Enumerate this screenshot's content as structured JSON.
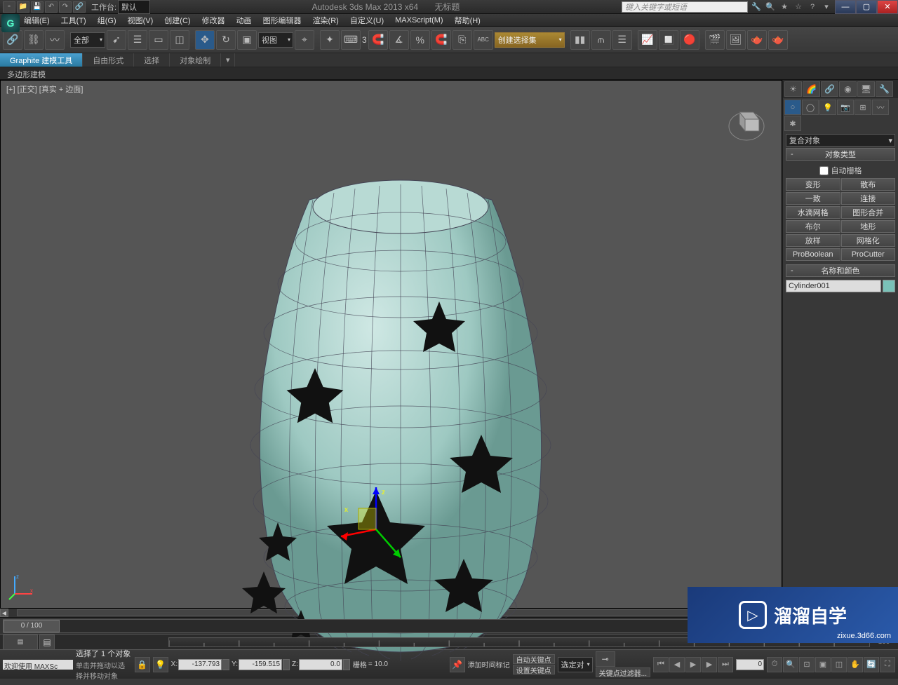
{
  "titlebar": {
    "workspace_label": "工作台:",
    "workspace_value": "默认",
    "app_title": "Autodesk 3ds Max  2013 x64",
    "doc_title": "无标题",
    "search_placeholder": "键入关键字或短语"
  },
  "menus": {
    "edit": "编辑(E)",
    "tools": "工具(T)",
    "group": "组(G)",
    "views": "视图(V)",
    "create": "创建(C)",
    "modifiers": "修改器",
    "animation": "动画",
    "graph": "图形编辑器",
    "rendering": "渲染(R)",
    "customize": "自定义(U)",
    "maxscript": "MAXScript(M)",
    "help": "帮助(H)"
  },
  "toolbar": {
    "filter_all": "全部",
    "ref_sys": "视图",
    "named_set_placeholder": "创建选择集",
    "snap_value": "3"
  },
  "ribbon": {
    "tab1": "Graphite 建模工具",
    "tab2": "自由形式",
    "tab3": "选择",
    "tab4": "对象绘制",
    "sub": "多边形建模"
  },
  "viewport": {
    "label": "[+] [正交] [真实 + 边面]"
  },
  "command_panel": {
    "category": "复合对象",
    "rollout_types": "对象类型",
    "auto_grid": "自动栅格",
    "buttons": {
      "morph": "变形",
      "scatter": "散布",
      "conform": "一致",
      "connect": "连接",
      "blobmesh": "水滴网格",
      "shapemerge": "图形合并",
      "boolean": "布尔",
      "terrain": "地形",
      "loft": "放样",
      "mesher": "网格化",
      "proboolean": "ProBoolean",
      "procutter": "ProCutter"
    },
    "rollout_name": "名称和颜色",
    "object_name": "Cylinder001"
  },
  "timeline": {
    "slider_text": "0 / 100",
    "start": "0",
    "end": "100",
    "current": "0"
  },
  "status": {
    "welcome": "欢迎使用 MAXSc",
    "selection": "选择了 1 个对象",
    "hint": "单击并拖动以选择并移动对象",
    "x": "-137.793",
    "y": "-159.515",
    "z": "0.0",
    "grid_label": "栅格",
    "grid_value": "= 10.0",
    "autokey": "自动关键点",
    "setkey": "设置关键点",
    "keyfilter": "关键点过滤器...",
    "selected_dd": "选定对",
    "add_time_tag": "添加时间标记"
  },
  "watermark": {
    "text": "溜溜自学",
    "url": "zixue.3d66.com"
  }
}
